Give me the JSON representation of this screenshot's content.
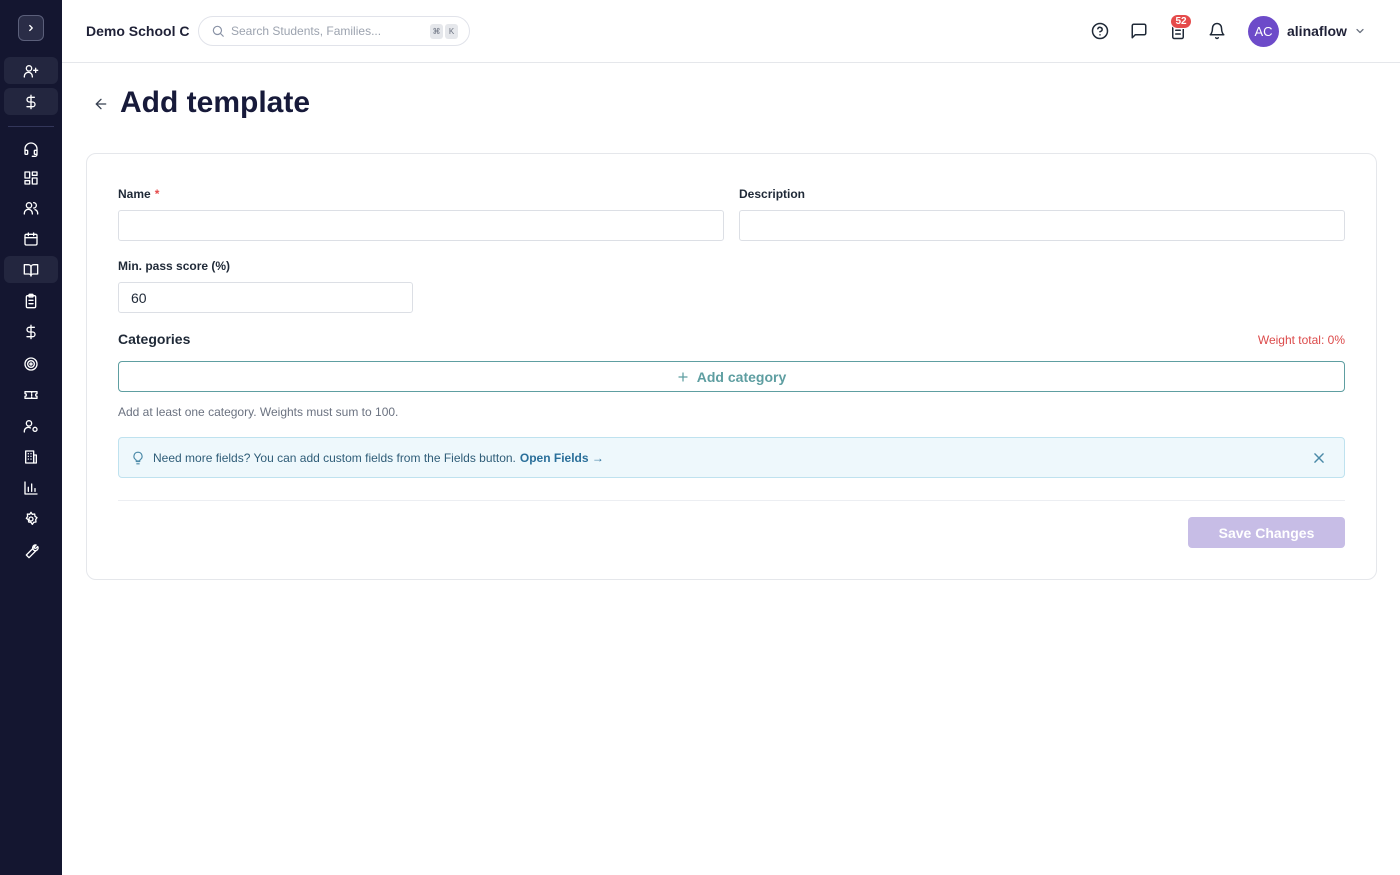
{
  "header": {
    "school_name": "Demo School C",
    "search_placeholder": "Search Students, Families...",
    "shortcut_key_1": "⌘",
    "shortcut_key_2": "K",
    "tasks_badge_count": "52",
    "avatar_initials": "AC",
    "username": "alinaflow"
  },
  "page": {
    "title": "Add template"
  },
  "form": {
    "name_label": "Name",
    "name_required_marker": "*",
    "name_value": "",
    "description_label": "Description",
    "description_value": "",
    "min_pass_label": "Min. pass score (%)",
    "min_pass_value": "60",
    "categories_title": "Categories",
    "weight_total": "Weight total: 0%",
    "add_category_label": "Add category",
    "hint": "Add at least one category. Weights must sum to 100.",
    "save_label": "Save Changes"
  },
  "info_banner": {
    "text": "Need more fields? You can add custom fields from the Fields button.",
    "link": "Open Fields →"
  },
  "colors": {
    "sidebar_bg": "#141630",
    "accent_teal": "#5e9ea1",
    "save_disabled": "#c7bde6",
    "error_red": "#dc4a4a",
    "avatar": "#6d4bc9"
  }
}
